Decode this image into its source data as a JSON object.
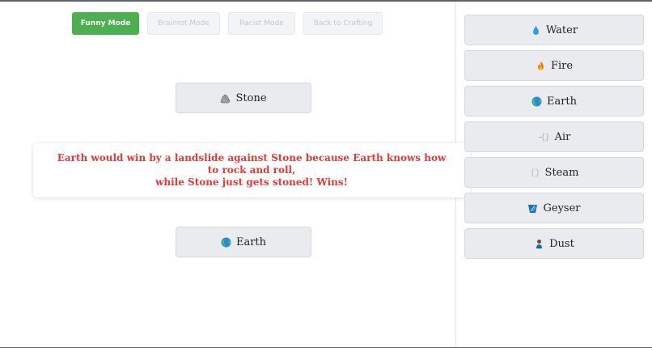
{
  "modes": {
    "funny": "Funny Mode",
    "brainrot": "Brainrot Mode",
    "racist": "Racist Mode",
    "back": "Back to Crafting"
  },
  "battle": {
    "top": {
      "label": "Stone",
      "icon": "rock-icon"
    },
    "bottom": {
      "label": "Earth",
      "icon": "globe-icon"
    },
    "result_line1": "Earth would win by a landslide against Stone because Earth knows how to rock and roll,",
    "result_line2": "while Stone just gets stoned! Wins!"
  },
  "sidebar": {
    "items": [
      {
        "label": "Water",
        "icon": "water-drop-icon"
      },
      {
        "label": "Fire",
        "icon": "fire-icon"
      },
      {
        "label": "Earth",
        "icon": "globe-icon"
      },
      {
        "label": "Air",
        "icon": "wind-icon"
      },
      {
        "label": "Steam",
        "icon": "steam-icon"
      },
      {
        "label": "Geyser",
        "icon": "geyser-icon"
      },
      {
        "label": "Dust",
        "icon": "dust-person-icon"
      }
    ]
  },
  "colors": {
    "active_mode": "#4caf50",
    "result_text": "#e53935",
    "card_bg": "#e9ebee"
  }
}
